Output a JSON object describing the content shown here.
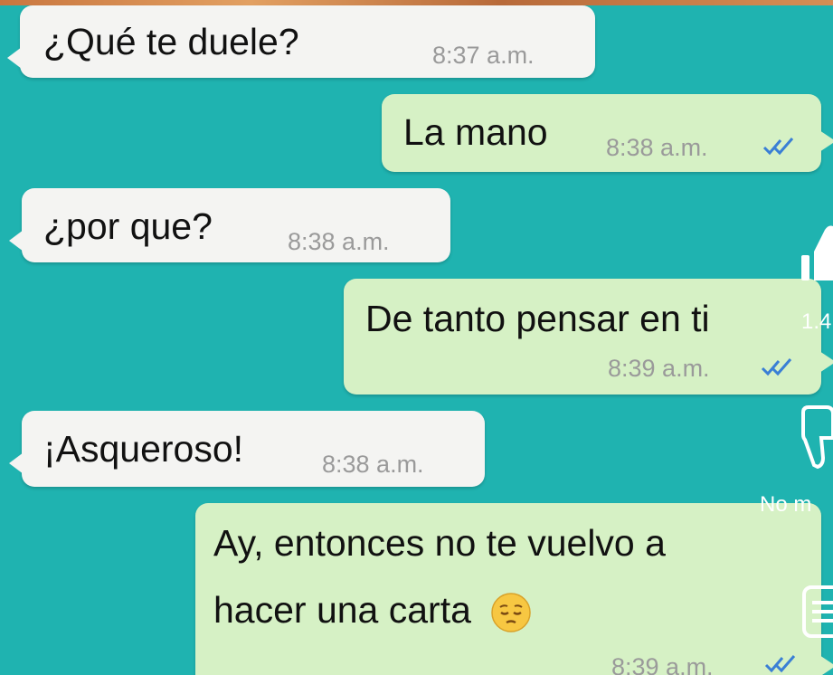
{
  "messages": [
    {
      "text": "¿Qué te duele?",
      "time": "8:37 a.m."
    },
    {
      "text": "La mano",
      "time": "8:38 a.m."
    },
    {
      "text": "¿por que?",
      "time": "8:38 a.m."
    },
    {
      "text": "De tanto pensar en ti",
      "time": "8:39 a.m."
    },
    {
      "text": "¡Asqueroso!",
      "time": "8:38 a.m."
    },
    {
      "line1": "Ay, entonces no te vuelvo a",
      "line2": "hacer una carta",
      "time": "8:39 a.m."
    }
  ],
  "side_actions": {
    "like_count": "1.4",
    "dislike_label": "No m"
  },
  "colors": {
    "background": "#1fb3b0",
    "incoming_bubble": "#f4f4f2",
    "outgoing_bubble": "#d6f1c5",
    "read_ticks": "#3a7fd5"
  },
  "icons": [
    "double-check-icon",
    "pensive-face-emoji",
    "thumbs-up-icon",
    "thumbs-down-icon",
    "menu-icon"
  ]
}
